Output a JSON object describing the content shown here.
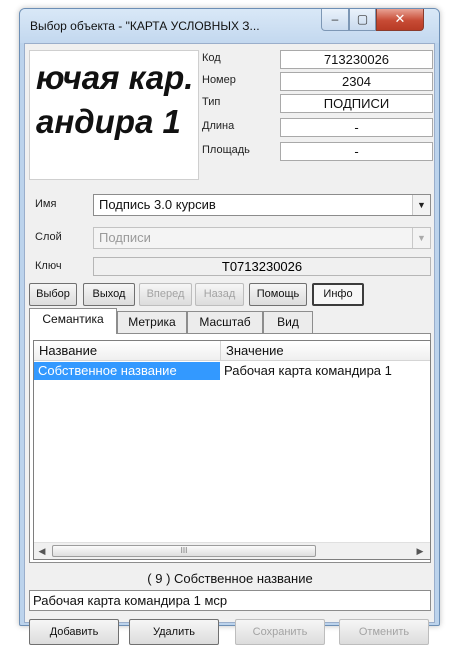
{
  "window": {
    "title": "Выбор объекта - \"КАРТА УСЛОВНЫХ З...",
    "minimize": "–",
    "maximize": "▢",
    "close": "✕"
  },
  "preview": {
    "line1": "ючая кар.",
    "line2": "андира 1"
  },
  "properties": [
    {
      "label": "Код",
      "value": "713230026"
    },
    {
      "label": "Номер",
      "value": "2304"
    },
    {
      "label": "Тип",
      "value": "ПОДПИСИ"
    },
    {
      "label": "Длина",
      "value": "-"
    },
    {
      "label": "Площадь",
      "value": "-"
    }
  ],
  "fields": {
    "name_label": "Имя",
    "name_value": "Подпись 3.0 курсив",
    "layer_label": "Слой",
    "layer_value": "Подписи",
    "key_label": "Ключ",
    "key_value": "T0713230026"
  },
  "toolbar": {
    "select": "Выбор",
    "exit": "Выход",
    "forward": "Вперед",
    "back": "Назад",
    "help": "Помощь",
    "info": "Инфо"
  },
  "tabs": [
    "Семантика",
    "Метрика",
    "Масштаб",
    "Вид"
  ],
  "table": {
    "columns": [
      "Название",
      "Значение"
    ],
    "rows": [
      {
        "name": "Собственное название",
        "value": "Рабочая карта  командира 1"
      }
    ]
  },
  "caption": "( 9 ) Собственное название",
  "value_text": "Рабочая карта  командира 1 мср",
  "bottom_buttons": {
    "add": "Добавить",
    "delete": "Удалить",
    "save": "Сохранить",
    "cancel": "Отменить"
  },
  "scroll": {
    "thumb_grip": "III"
  }
}
